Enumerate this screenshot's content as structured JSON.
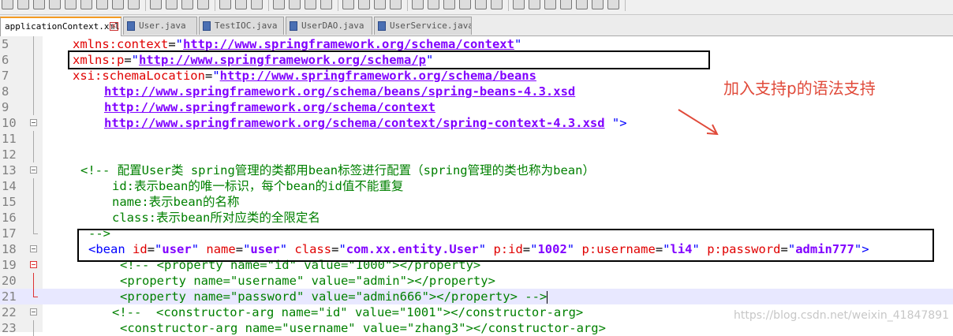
{
  "tabs": [
    {
      "label": "applicationContext.xml",
      "active": true,
      "close": "x"
    },
    {
      "label": "User.java",
      "active": false
    },
    {
      "label": "TestIOC.java",
      "active": false
    },
    {
      "label": "UserDAO.java",
      "active": false
    },
    {
      "label": "UserService.java",
      "active": false
    }
  ],
  "lines": [
    {
      "num": "5",
      "text": "xmlns:context=\"http://www.springframework.org/schema/context\""
    },
    {
      "num": "6",
      "text": "xmlns:p=\"http://www.springframework.org/schema/p\""
    },
    {
      "num": "7",
      "text": "xsi:schemaLocation=\"http://www.springframework.org/schema/beans"
    },
    {
      "num": "8",
      "text": "http://www.springframework.org/schema/beans/spring-beans-4.3.xsd"
    },
    {
      "num": "9",
      "text": "http://www.springframework.org/schema/context"
    },
    {
      "num": "10",
      "text": "http://www.springframework.org/schema/context/spring-context-4.3.xsd \">"
    },
    {
      "num": "11",
      "text": ""
    },
    {
      "num": "12",
      "text": ""
    },
    {
      "num": "13",
      "text": "<!-- 配置User类 spring管理的类都用bean标签进行配置（spring管理的类也称为bean）"
    },
    {
      "num": "14",
      "text": "id:表示bean的唯一标识，每个bean的id值不能重复"
    },
    {
      "num": "15",
      "text": "name:表示bean的名称"
    },
    {
      "num": "16",
      "text": "class:表示bean所对应类的全限定名"
    },
    {
      "num": "17",
      "text": "-->"
    },
    {
      "num": "18",
      "text": "<bean id=\"user\" name=\"user\" class=\"com.xx.entity.User\" p:id=\"1002\" p:username=\"li4\" p:password=\"admin777\">"
    },
    {
      "num": "19",
      "text": "<!-- <property name=\"id\" value=\"1000\"></property>"
    },
    {
      "num": "20",
      "text": "<property name=\"username\" value=\"admin\"></property>"
    },
    {
      "num": "21",
      "text": "<property name=\"password\" value=\"admin666\"></property> -->"
    },
    {
      "num": "22",
      "text": "<!--  <constructor-arg name=\"id\" value=\"1001\"></constructor-arg>"
    },
    {
      "num": "23",
      "text": "<constructor-arg name=\"username\" value=\"zhang3\"></constructor-arg>"
    }
  ],
  "annotation": {
    "text": "加入支持p的语法支持"
  },
  "watermark": "https://blog.csdn.net/weixin_41847891",
  "colors": {
    "annotation": "#e04a3a",
    "attr": "#e00000",
    "value": "#8000ff",
    "comment": "#008000",
    "tag": "#0000ff",
    "current_line": "#e8e8ff"
  }
}
